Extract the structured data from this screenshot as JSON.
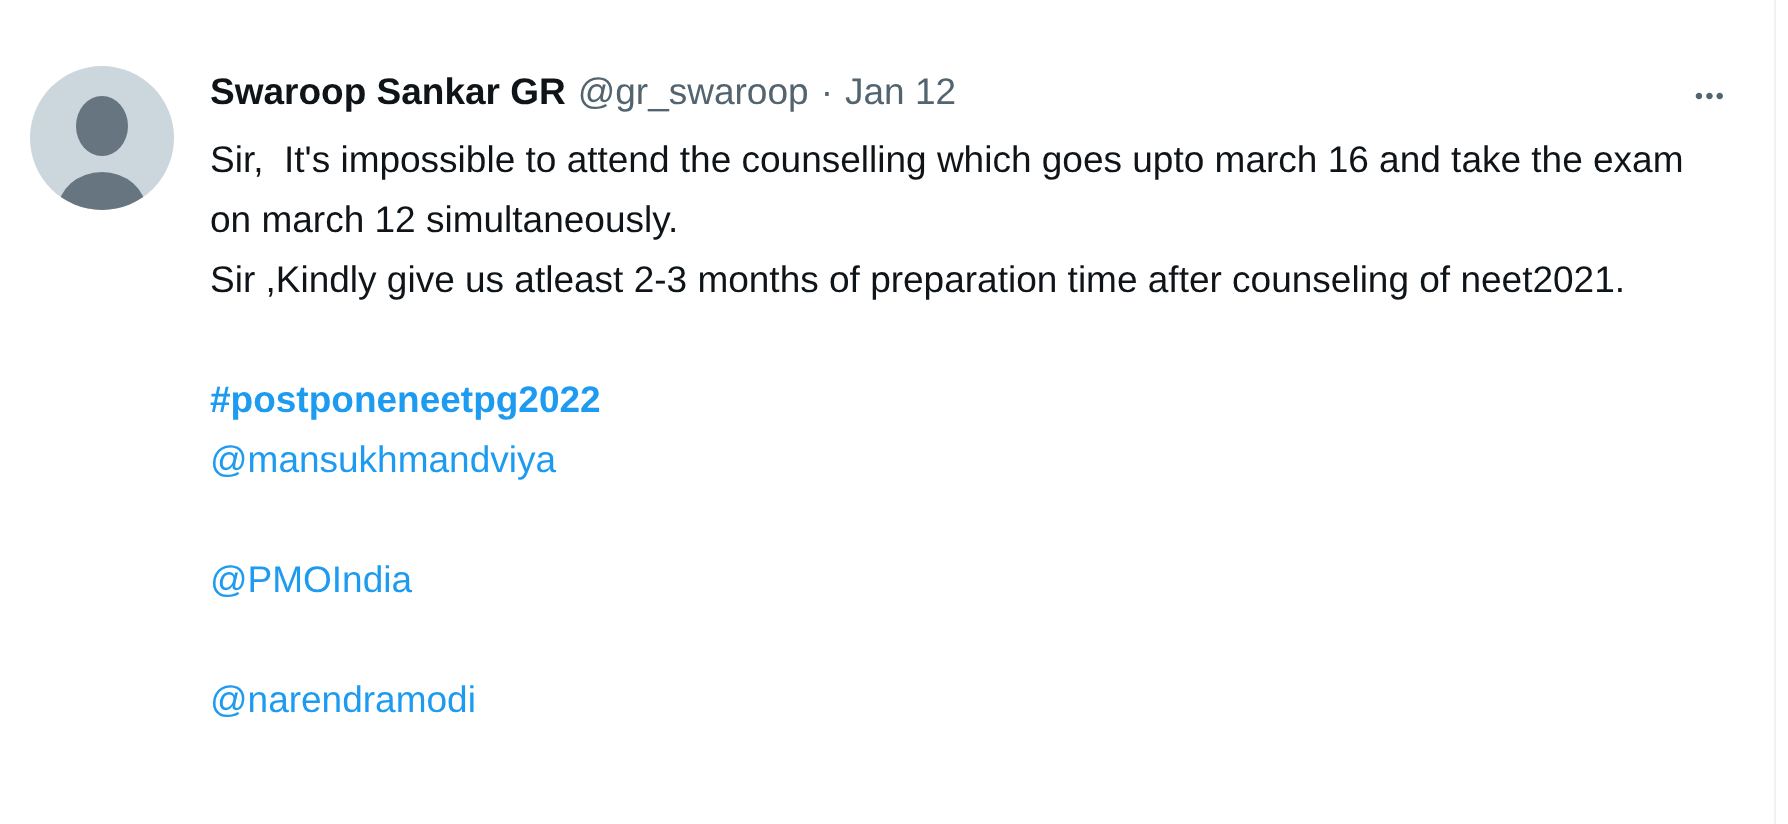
{
  "tweet": {
    "author": "Swaroop Sankar GR",
    "handle": "@gr_swaroop",
    "separator": "·",
    "date": "Jan 12",
    "more": "•••",
    "paragraphs": [
      [
        {
          "kind": "text",
          "text": "Sir,  It's impossible to attend the counselling which goes upto march 16 and take the exam on march 12 simultaneously."
        },
        {
          "kind": "text",
          "text": "Sir ,Kindly give us atleast 2-3 months of preparation time after counseling of neet2021."
        }
      ],
      [
        {
          "kind": "hashtag",
          "text": "#postponeneetpg2022"
        },
        {
          "kind": "mention",
          "text": "@mansukhmandviya"
        }
      ],
      [
        {
          "kind": "mention",
          "text": "@PMOIndia"
        }
      ],
      [
        {
          "kind": "mention",
          "text": "@narendramodi"
        }
      ]
    ]
  }
}
